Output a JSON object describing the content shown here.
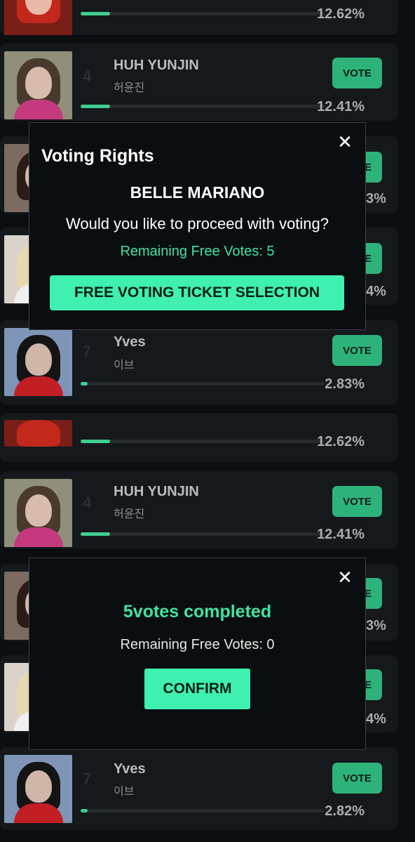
{
  "vote_label": "VOTE",
  "rows": {
    "r0": {
      "pct": "12.62%",
      "progress": 0.1262
    },
    "r1": {
      "rank": "4",
      "name": "HUH YUNJIN",
      "sub": "허윤진",
      "pct": "12.41%",
      "progress": 0.1241
    },
    "r2": {
      "pct_peek": "3%"
    },
    "r3": {
      "pct_peek": "4%"
    },
    "r4": {
      "rank": "7",
      "name": "Yves",
      "sub": "이브",
      "pct": "2.83%",
      "progress": 0.0283
    },
    "r5": {
      "pct": "12.62%",
      "progress": 0.1262
    },
    "r6": {
      "rank": "4",
      "name": "HUH YUNJIN",
      "sub": "허윤진",
      "pct": "12.41%",
      "progress": 0.1241
    },
    "r7": {
      "pct_peek": "3%"
    },
    "r8": {
      "pct_peek": "4%"
    },
    "r9": {
      "rank": "7",
      "name": "Yves",
      "sub": "이브",
      "pct": "2.82%",
      "progress": 0.0282
    }
  },
  "vote_peek": "E",
  "modal_rights": {
    "title": "Voting Rights",
    "candidate": "BELLE MARIANO",
    "question": "Would you like to proceed with voting?",
    "remaining": "Remaining Free Votes: 5",
    "button": "FREE VOTING TICKET SELECTION",
    "close_glyph": "✕"
  },
  "modal_done": {
    "title": "5votes completed",
    "remaining": "Remaining Free Votes: 0",
    "button": "CONFIRM",
    "close_glyph": "✕"
  },
  "colors": {
    "accent": "#3ff0b0",
    "vote_button": "#2db37a",
    "bar_fill": "#3fcf8e",
    "background": "#0c0f11"
  }
}
